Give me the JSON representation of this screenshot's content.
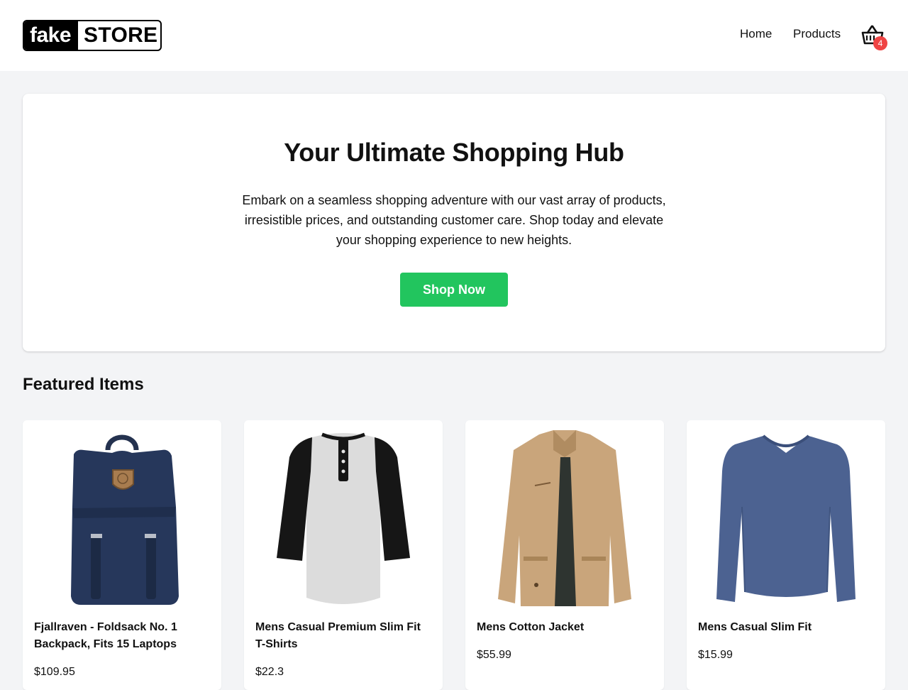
{
  "header": {
    "logo": {
      "part1": "fake",
      "part2": "STORE"
    },
    "nav": [
      {
        "label": "Home"
      },
      {
        "label": "Products"
      }
    ],
    "cart": {
      "icon": "basket-icon",
      "count": "4",
      "badge_color": "#ef4444"
    }
  },
  "hero": {
    "title": "Your Ultimate Shopping Hub",
    "description": "Embark on a seamless shopping adventure with our vast array of products, irresistible prices, and outstanding customer care. Shop today and elevate your shopping experience to new heights.",
    "button_label": "Shop Now",
    "button_color": "#22c55e"
  },
  "featured": {
    "title": "Featured Items",
    "products": [
      {
        "name": "Fjallraven - Foldsack No. 1 Backpack, Fits 15 Laptops",
        "price": "$109.95",
        "image": "navy-backpack"
      },
      {
        "name": "Mens Casual Premium Slim Fit T-Shirts",
        "price": "$22.3",
        "image": "raglan-henley-shirt"
      },
      {
        "name": "Mens Cotton Jacket",
        "price": "$55.99",
        "image": "khaki-jacket"
      },
      {
        "name": "Mens Casual Slim Fit",
        "price": "$15.99",
        "image": "blue-long-sleeve-shirt"
      }
    ]
  }
}
